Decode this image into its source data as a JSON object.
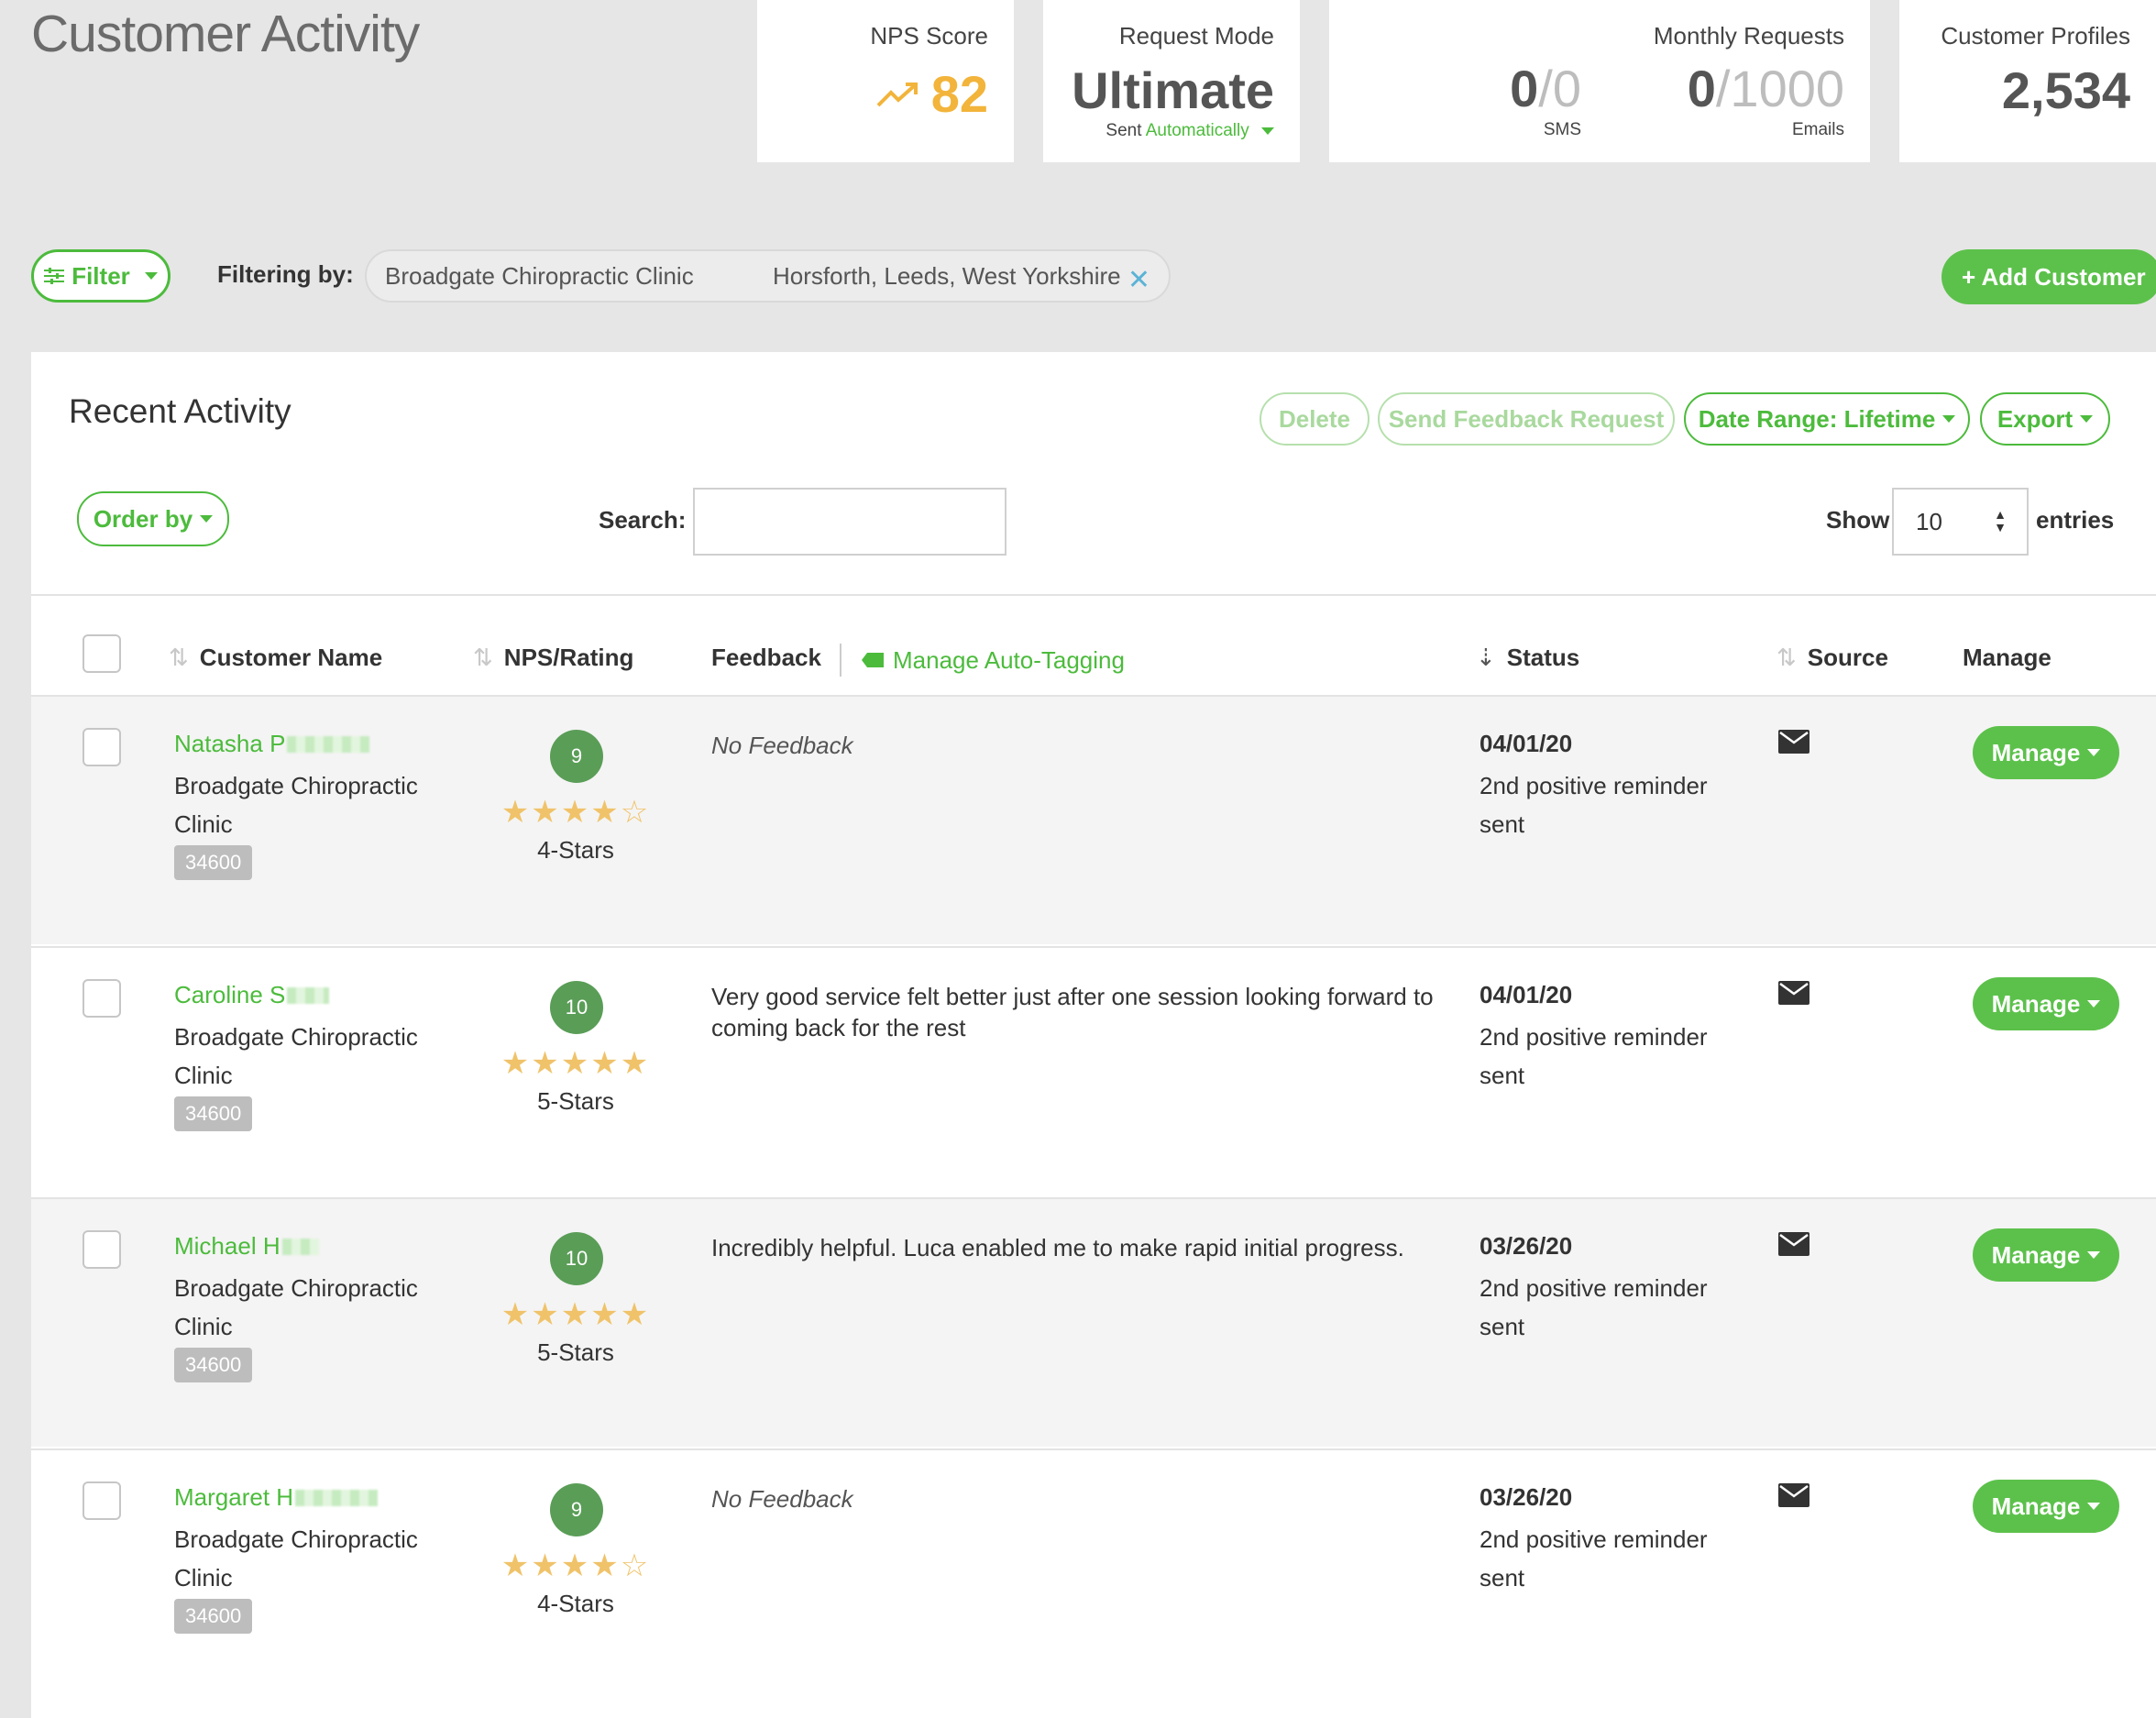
{
  "page": {
    "title": "Customer Activity"
  },
  "stats": {
    "nps": {
      "label": "NPS Score",
      "value": "82",
      "icon": "trending-up-icon"
    },
    "request_mode": {
      "label": "Request Mode",
      "value": "Ultimate",
      "sent_prefix": "Sent",
      "sent_mode": "Automatically"
    },
    "monthly": {
      "label": "Monthly Requests",
      "sms_used": "0",
      "sms_limit": "0",
      "sms_label": "SMS",
      "email_used": "0",
      "email_limit": "1000",
      "email_label": "Emails"
    },
    "profiles": {
      "label": "Customer Profiles",
      "value": "2,534"
    }
  },
  "filter": {
    "button_label": "Filter",
    "filtering_by_label": "Filtering by:",
    "chip_location": "Broadgate Chiropractic Clinic",
    "chip_area": "Horsforth, Leeds, West Yorkshire",
    "add_customer_label": "+ Add Customer"
  },
  "panel": {
    "title": "Recent Activity",
    "delete_label": "Delete",
    "send_feedback_label": "Send Feedback Request",
    "date_range_label": "Date Range: Lifetime",
    "export_label": "Export",
    "order_by_label": "Order by",
    "search_label": "Search:",
    "search_value": "",
    "show_label": "Show",
    "show_value": "10",
    "entries_label": "entries"
  },
  "table": {
    "headers": {
      "customer_name": "Customer Name",
      "nps_rating": "NPS/Rating",
      "feedback": "Feedback",
      "manage_tagging": "Manage Auto-Tagging",
      "status": "Status",
      "source": "Source",
      "manage": "Manage"
    },
    "rows": [
      {
        "first_name": "Natasha P",
        "location": "Broadgate Chiropractic Clinic",
        "id": "34600",
        "score": "9",
        "stars": "★★★★☆",
        "rating_label": "4-Stars",
        "feedback": "No Feedback",
        "date": "04/01/20",
        "status": "2nd positive reminder sent",
        "source_icon": "email-icon",
        "manage_label": "Manage"
      },
      {
        "first_name": "Caroline S",
        "location": "Broadgate Chiropractic Clinic",
        "id": "34600",
        "score": "10",
        "stars": "★★★★★",
        "rating_label": "5-Stars",
        "feedback": "Very good service felt better just after one session looking forward to coming back for the rest",
        "date": "04/01/20",
        "status": "2nd positive reminder sent",
        "source_icon": "email-icon",
        "manage_label": "Manage"
      },
      {
        "first_name": "Michael H",
        "location": "Broadgate Chiropractic Clinic",
        "id": "34600",
        "score": "10",
        "stars": "★★★★★",
        "rating_label": "5-Stars",
        "feedback": "Incredibly helpful. Luca enabled me to make rapid initial progress.",
        "date": "03/26/20",
        "status": "2nd positive reminder sent",
        "source_icon": "email-icon",
        "manage_label": "Manage"
      },
      {
        "first_name": "Margaret H",
        "location": "Broadgate Chiropractic Clinic",
        "id": "34600",
        "score": "9",
        "stars": "★★★★☆",
        "rating_label": "4-Stars",
        "feedback": "No Feedback",
        "date": "03/26/20",
        "status": "2nd positive reminder sent",
        "source_icon": "email-icon",
        "manage_label": "Manage"
      }
    ]
  },
  "colors": {
    "accent": "#4cbb3c",
    "nps": "#f2b43a",
    "badge": "#5a9d57"
  }
}
